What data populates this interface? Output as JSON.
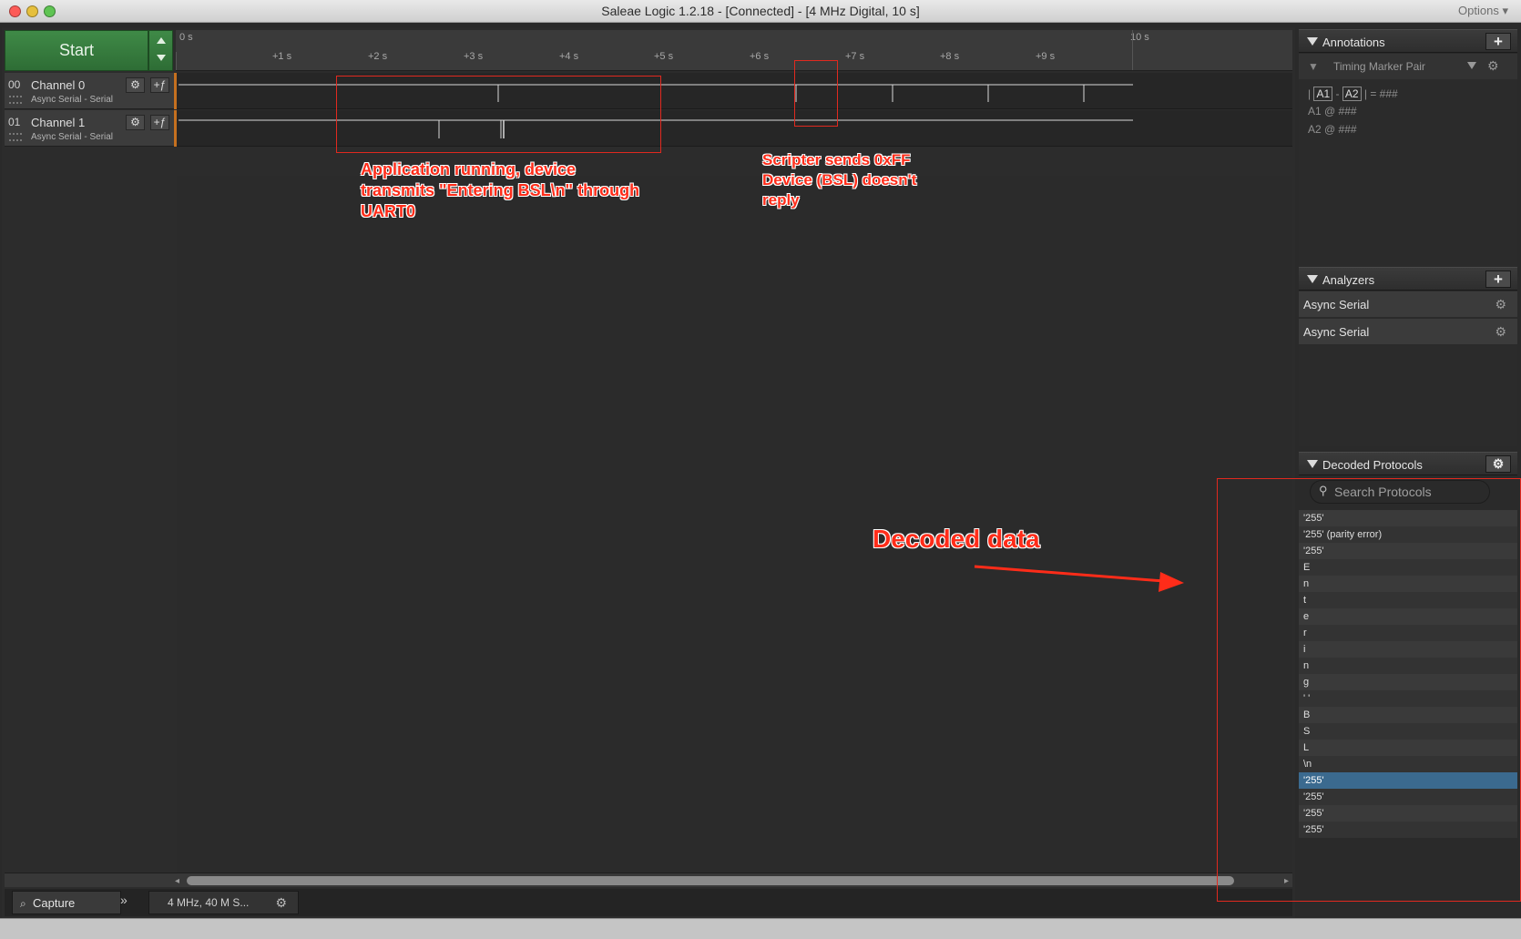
{
  "window": {
    "title": "Saleae Logic 1.2.18 - [Connected] - [4 MHz Digital, 10 s]",
    "options_label": "Options ▾"
  },
  "toolbar": {
    "start_label": "Start"
  },
  "timeline": {
    "start_label": "0 s",
    "end_label": "10 s",
    "ticks": [
      "+1 s",
      "+2 s",
      "+3 s",
      "+4 s",
      "+5 s",
      "+6 s",
      "+7 s",
      "+8 s",
      "+9 s"
    ]
  },
  "channels": [
    {
      "number": "00",
      "name": "Channel 0",
      "subtitle": "Async Serial - Serial"
    },
    {
      "number": "01",
      "name": "Channel 1",
      "subtitle": "Async Serial - Serial"
    }
  ],
  "bottom": {
    "capture_label": "Capture",
    "rate_label": "4 MHz, 40 M S..."
  },
  "annotations_panel": {
    "title": "Annotations",
    "marker_pair_label": "Timing Marker Pair",
    "line1": {
      "a1": "A1",
      "dash": "-",
      "a2": "A2",
      "eq": "= ###"
    },
    "a1_line": "A1  @  ###",
    "a2_line": "A2  @  ###"
  },
  "analyzers_panel": {
    "title": "Analyzers",
    "items": [
      "Async Serial",
      "Async Serial"
    ]
  },
  "decoded_panel": {
    "title": "Decoded Protocols",
    "search_placeholder": "Search Protocols",
    "items": [
      "'255'",
      "'255' (parity error)",
      "'255'",
      "E",
      "n",
      "t",
      "e",
      "r",
      "i",
      "n",
      "g",
      "' '",
      "B",
      "S",
      "L",
      "\\n",
      "'255'",
      "'255'",
      "'255'",
      "'255'"
    ],
    "selected_index": 16
  },
  "overlay_notes": {
    "note1": "Application running, device\ntransmits \"Entering BSL\\n\" through\nUART0",
    "note2": "Scripter sends 0xFF\nDevice (BSL) doesn't\nreply",
    "note3": "Decoded data"
  },
  "colors": {
    "start_green": "#3f8a47",
    "annotation_red": "#ff2c19",
    "selection_blue": "#3b6a8f",
    "channel_accent": "#c5701f"
  }
}
